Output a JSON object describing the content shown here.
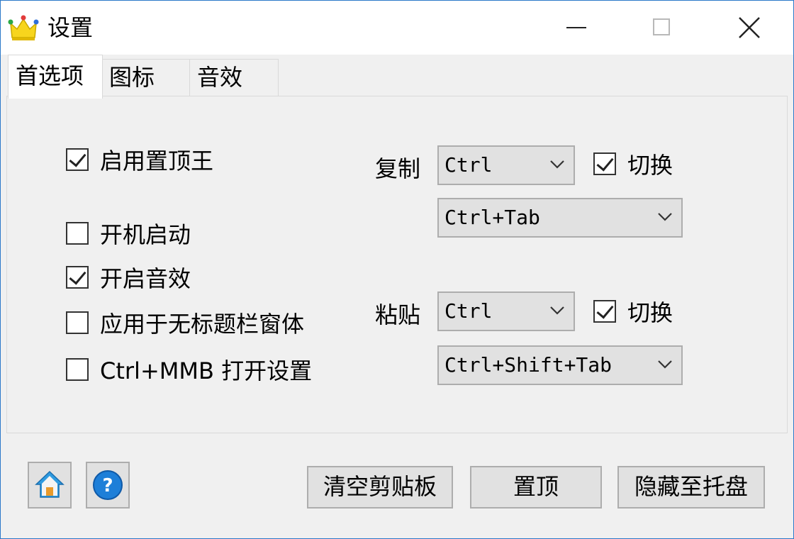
{
  "window": {
    "title": "设置"
  },
  "tabs": [
    {
      "label": "首选项",
      "active": true
    },
    {
      "label": "图标",
      "active": false
    },
    {
      "label": "音效",
      "active": false
    }
  ],
  "options": [
    {
      "label": "启用置顶王",
      "checked": true
    },
    {
      "label": "开机启动",
      "checked": false
    },
    {
      "label": "开启音效",
      "checked": true
    },
    {
      "label": "应用于无标题栏窗体",
      "checked": false
    },
    {
      "label": "Ctrl+MMB 打开设置",
      "checked": false
    }
  ],
  "copy": {
    "label": "复制",
    "modifier": "Ctrl",
    "toggle_label": "切换",
    "toggle_checked": true,
    "shortcut": "Ctrl+Tab"
  },
  "paste": {
    "label": "粘贴",
    "modifier": "Ctrl",
    "toggle_label": "切换",
    "toggle_checked": true,
    "shortcut": "Ctrl+Shift+Tab"
  },
  "footer": {
    "home_icon": "home-icon",
    "help_icon": "help-icon",
    "clear_clipboard_label": "清空剪贴板",
    "pin_top_label": "置顶",
    "hide_to_tray_label": "隐藏至托盘"
  },
  "colors": {
    "accent": "#0078d7",
    "button_face": "#e1e1e1"
  }
}
